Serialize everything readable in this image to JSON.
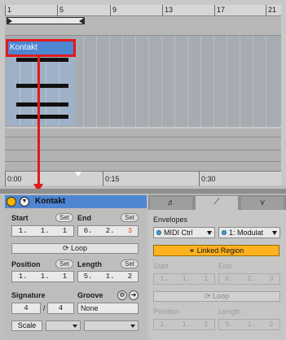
{
  "arrangement": {
    "bar_numbers": [
      "1",
      "5",
      "9",
      "13",
      "17",
      "21"
    ],
    "clip_name": "Kontakt",
    "time_labels": [
      "0:00",
      "0:15",
      "0:30"
    ]
  },
  "clip_panel": {
    "title": "Kontakt",
    "collapse_glyph": "▼",
    "start_label": "Start",
    "end_label": "End",
    "set_label": "Set",
    "start_value": "1.   1.   1",
    "end_value_main": "6.   2.",
    "end_value_last": "3",
    "loop_label": "Loop",
    "position_label": "Position",
    "length_label": "Length",
    "position_value": "1.   1.   1",
    "length_value": "5.   1.   2",
    "signature_label": "Signature",
    "groove_label": "Groove",
    "sig_num": "4",
    "sig_slash": "/",
    "sig_den": "4",
    "groove_value": "None",
    "scale_label": "Scale"
  },
  "envelope_panel": {
    "tabs": [
      "♬",
      "⟋",
      "⋎"
    ],
    "envelopes_label": "Envelopes",
    "device_select": "MIDI Ctrl",
    "control_select": "1: Modulat",
    "linked_label": "Linked Region",
    "start_label": "Start",
    "end_label": "End",
    "start_value": "1.   1.   1",
    "end_value": "6.   2.   3",
    "loop_label": "Loop",
    "position_label": "Position",
    "length_label": "Length",
    "position_value": "1.   1.   1",
    "length_value": "5.   1.   2"
  }
}
